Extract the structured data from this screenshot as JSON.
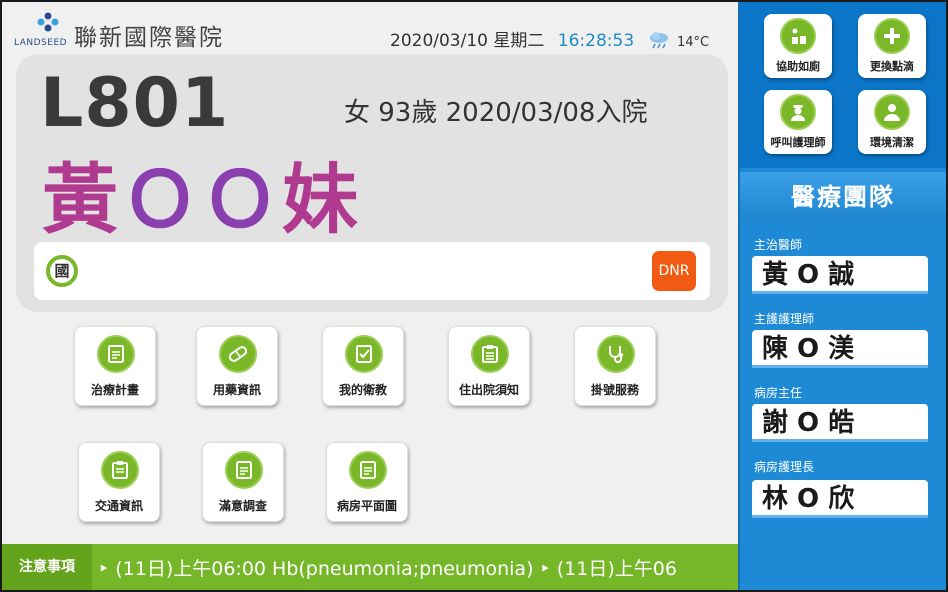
{
  "header": {
    "logo_brand": "LANDSEED",
    "hospital_name": "聯新國際醫院",
    "date": "2020/03/10 星期二",
    "time": "16:28:53",
    "weather_icon": "cloud-rain-icon",
    "temperature": "14°C"
  },
  "patient": {
    "bed": "L801",
    "info": "女 93歲 2020/03/08入院",
    "name_part1": "黃",
    "name_part2": "ＯＯ",
    "name_part3": "妹",
    "tag_language": "國",
    "tag_dnr": "DNR"
  },
  "services": {
    "row1": [
      "治療計畫",
      "用藥資訊",
      "我的衛教",
      "住出院須知",
      "掛號服務"
    ],
    "row2": [
      "交通資訊",
      "滿意調查",
      "病房平面圖"
    ]
  },
  "notice": {
    "label": "注意事項",
    "text": "‣ (11日)上午06:00 Hb(pneumonia;pneumonia)  ‣ (11日)上午06"
  },
  "actions": {
    "toilet": "協助如廁",
    "drip": "更換點滴",
    "nurse": "呼叫護理師",
    "clean": "環境清潔"
  },
  "team": {
    "title": "醫療團隊",
    "roles": [
      {
        "role": "主治醫師",
        "name": "黃 O 誠"
      },
      {
        "role": "主護護理師",
        "name": "陳 O 渼"
      },
      {
        "role": "病房主任",
        "name": "謝 O 皓"
      },
      {
        "role": "病房護理長",
        "name": "林 O 欣"
      }
    ]
  },
  "colors": {
    "accent_green": "#7ab829",
    "panel_blue": "#1e8ad6",
    "name_purple": "#b03a8f",
    "dnr_orange": "#f25a13"
  }
}
